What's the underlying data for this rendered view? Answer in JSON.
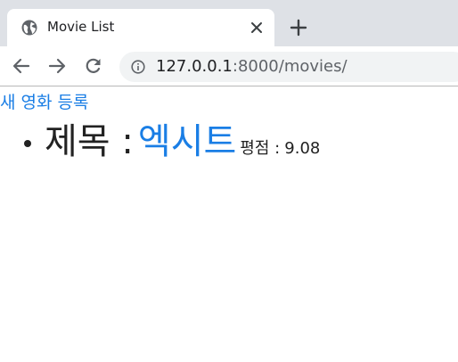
{
  "browser": {
    "tab_title": "Movie List",
    "url_host": "127.0.0.1",
    "url_rest": ":8000/movies/"
  },
  "page": {
    "new_movie_link": "새 영화 등록",
    "movies": [
      {
        "title_label": "제목 :",
        "title": "엑시트",
        "rating_label": "평점 :",
        "rating": "9.08"
      }
    ]
  },
  "colors": {
    "link": "#1a7ee5",
    "tabstrip_bg": "#dee1e6",
    "omnibox_bg": "#f1f3f4"
  },
  "icons": {
    "favicon": "globe-icon",
    "tab_close": "close-icon",
    "new_tab": "plus-icon",
    "back": "arrow-left-icon",
    "forward": "arrow-right-icon",
    "reload": "reload-icon",
    "site_info": "info-icon"
  }
}
